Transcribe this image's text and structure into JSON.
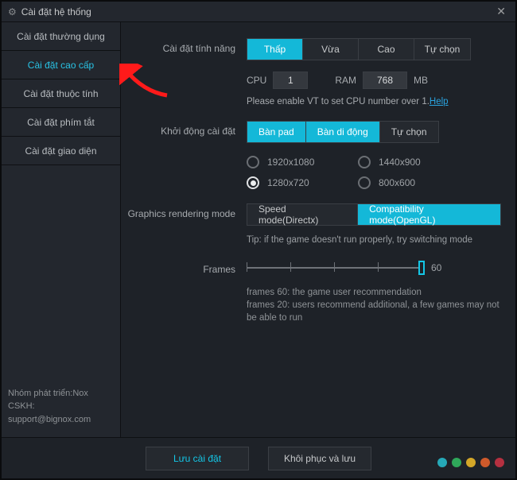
{
  "window": {
    "title": "Cài đặt hệ thống"
  },
  "sidebar": {
    "items": [
      {
        "label": "Cài đặt thường dụng"
      },
      {
        "label": "Cài đặt cao cấp",
        "active": true
      },
      {
        "label": "Cài đặt thuộc tính"
      },
      {
        "label": "Cài đặt phím tắt"
      },
      {
        "label": "Cài đặt giao diện"
      }
    ],
    "footer_line1": "Nhóm phát triển:Nox",
    "footer_line2": "CSKH:",
    "footer_line3": "support@bignox.com"
  },
  "perf": {
    "label": "Cài đặt tính năng",
    "options": [
      "Thấp",
      "Vừa",
      "Cao",
      "Tự chọn"
    ],
    "active_index": 0,
    "cpu_label": "CPU",
    "cpu_value": "1",
    "ram_label": "RAM",
    "ram_value": "768",
    "mb": "MB",
    "vt_text": "Please enable VT to set CPU number over 1.",
    "vt_link": "Help"
  },
  "startup": {
    "label": "Khởi động cài đặt",
    "options": [
      "Bàn pad",
      "Bàn di động",
      "Tự chọn"
    ],
    "active_indexes": [
      0,
      1
    ],
    "resolutions": [
      "1920x1080",
      "1440x900",
      "1280x720",
      "800x600"
    ],
    "selected_res": 2
  },
  "graphics": {
    "label": "Graphics rendering mode",
    "options": [
      "Speed mode(Directx)",
      "Compatibility mode(OpenGL)"
    ],
    "active_index": 1,
    "tip": "Tip: if the game doesn't run properly, try switching mode"
  },
  "frames": {
    "label": "Frames",
    "value": "60",
    "note1": "frames 60: the game user recommendation",
    "note2": "frames 20: users recommend additional, a few games may not be able to run"
  },
  "footer": {
    "save": "Lưu cài đặt",
    "restore": "Khôi phục và lưu"
  },
  "dot_colors": [
    "#26a9b8",
    "#2fa85a",
    "#d4a728",
    "#cf5a2b",
    "#b53040"
  ]
}
